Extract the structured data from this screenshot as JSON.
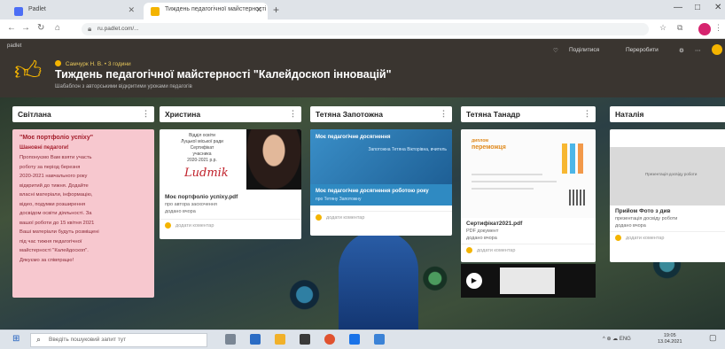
{
  "browser": {
    "tabs": [
      {
        "title": "Padlet"
      },
      {
        "title": "Тиждень педагогічної майстерності"
      }
    ],
    "new_tab": "+",
    "url": "ru.padlet.com/...",
    "controls": {
      "minimize": "—",
      "maximize": "□",
      "close": "✕"
    }
  },
  "header": {
    "logo": "padlet",
    "author": "Самчурк Н. В. • 3 години",
    "title": "Тиждень педагогічної майстерності \"Калейдоскоп інновацій\"",
    "subtitle": "Шабаблон з авторськими відкритими уроками педагогів",
    "actions": {
      "like": "♡",
      "share": "Поділитися",
      "remake": "Переробити",
      "settings": "⚙",
      "more": "⋯"
    }
  },
  "columns": [
    {
      "name": "Світлана",
      "cards": [
        {
          "type": "pink",
          "title": "\"Моє портфоліо успіху\"",
          "subtitle": "Шановні педагоги!",
          "lines": [
            "Пропонуємо Вам взяти участь",
            "роботу за період березня",
            "2020-2021 навчального року",
            "відкритий до тижня. Додайте",
            "власні матеріали, інформацію,",
            "відео, подумки розширення",
            "досвідом освіти діяльності. За",
            "вашої роботи до 15 квітня 2021",
            "Ваші матеріали будуть розміщені",
            "під час тижня педагогічної",
            "майстерності \"Калейдоскоп\".",
            "Дякуємо за співпрацю!"
          ]
        }
      ]
    },
    {
      "name": "Христина",
      "cards": [
        {
          "type": "photo",
          "doc_lines": [
            "Відділ освіти",
            "Луцької міської ради",
            "Сертифікат",
            "учасника",
            "2020-2021 р.р."
          ],
          "signature": "Ludmik",
          "title": "Моє портфоліо успіху.pdf",
          "meta": "про автора заохочення",
          "date": "додано вчора",
          "reactions": "додати коментар"
        }
      ]
    },
    {
      "name": "Тетяна Запотожна",
      "cards": [
        {
          "type": "blue",
          "image_title": "Моє педагогічне досягнення",
          "image_sub": "Запотожна Тетяна Вікторівна, вчитель",
          "caption": "Моє педагогічне досягнення роботою року",
          "meta": "про Тетяну Запотожну",
          "reactions": "додати коментар"
        }
      ]
    },
    {
      "name": "Тетяна Танадр",
      "cards": [
        {
          "type": "certificate",
          "cert_top": "диплом",
          "cert_title": "переможця",
          "title": "Сертифікат2021.pdf",
          "meta": "PDF документ",
          "date": "додано вчора",
          "reactions": "додати коментар"
        }
      ]
    },
    {
      "name": "Наталія",
      "cards": [
        {
          "type": "grey",
          "image_text": "Презентація досвіду роботи",
          "title": "Прийом Фото з див",
          "meta": "презентація досвіду роботи",
          "date": "додано вчора",
          "reactions": "додати коментар"
        }
      ]
    }
  ],
  "taskbar": {
    "search_placeholder": "Введіть пошуковий запит тут",
    "tray": "^ ⊕ ☁ ENG",
    "time": "19:05",
    "date": "13.04.2021"
  },
  "colors": {
    "header_bg": "#3a3530",
    "accent": "#f4b400",
    "pink_card": "#f7c8cf",
    "blue_card": "#2f8ac2",
    "taskbar": "#dde3ea"
  }
}
